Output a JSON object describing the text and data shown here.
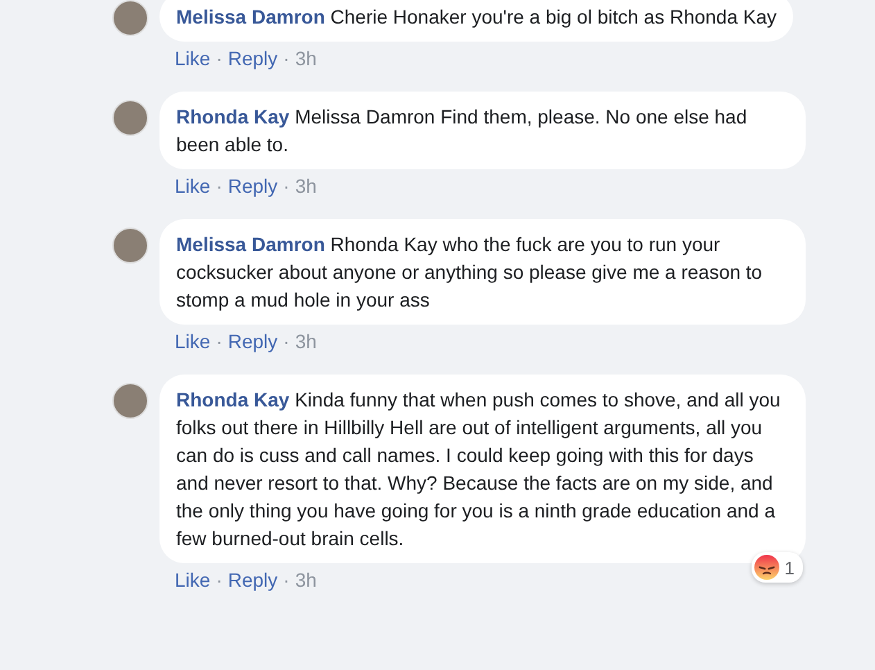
{
  "action_separator": "·",
  "comments": [
    {
      "author": "Melissa Damron",
      "text": "Cherie Honaker you're a big ol bitch as Rhonda Kay",
      "actions": [
        "Like",
        "Reply"
      ],
      "time": "3h"
    },
    {
      "author": "Rhonda Kay",
      "text": "Melissa Damron Find them, please. No one else had been able to.",
      "actions": [
        "Like",
        "Reply"
      ],
      "time": "3h"
    },
    {
      "author": "Melissa Damron",
      "text": "Rhonda Kay who the fuck are you to run your cocksucker about anyone or anything so please give me a reason to stomp a mud hole in your ass",
      "actions": [
        "Like",
        "Reply"
      ],
      "time": "3h"
    },
    {
      "author": "Rhonda Kay",
      "text": "Kinda funny that when push comes to shove, and all you folks out there in Hillbilly Hell are out of intelligent arguments, all you can do is cuss and call names. I could keep going with this for days and never resort to that. Why? Because the facts are on my side, and the only thing you have going for you is a ninth grade education and a few burned-out brain cells.",
      "actions": [
        "Like",
        "Reply"
      ],
      "time": "3h",
      "reaction": {
        "kind": "angry",
        "count": "1"
      }
    }
  ]
}
